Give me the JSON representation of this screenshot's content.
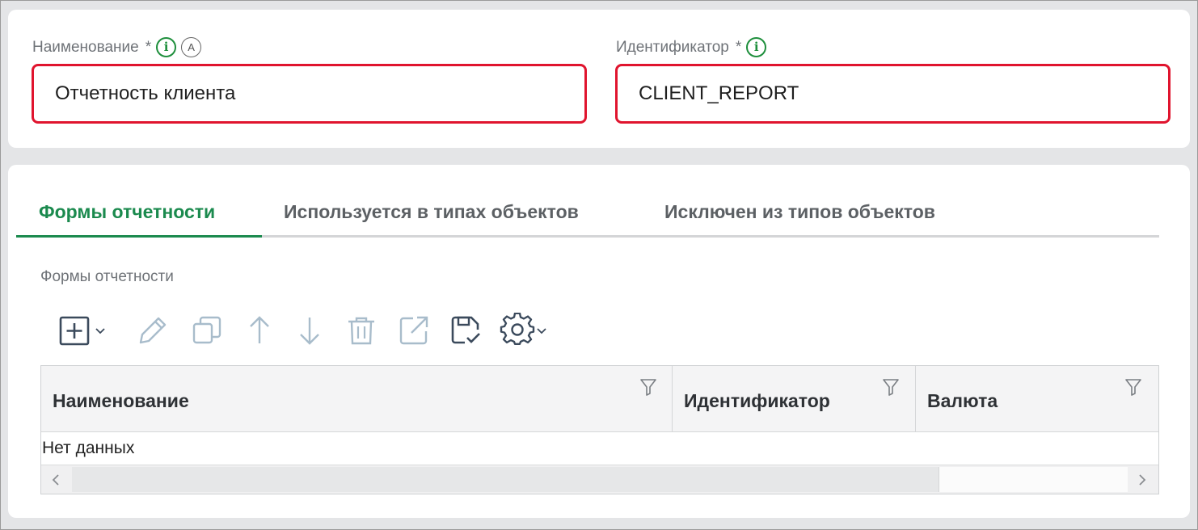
{
  "header_form": {
    "name_field": {
      "label": "Наименование",
      "required_mark": "*",
      "info_icon": "i",
      "auto_icon": "A",
      "value": "Отчетность клиента"
    },
    "id_field": {
      "label": "Идентификатор",
      "required_mark": "*",
      "info_icon": "i",
      "value": "CLIENT_REPORT"
    }
  },
  "tabs": [
    {
      "label": "Формы отчетности",
      "active": true
    },
    {
      "label": "Используется в типах объектов",
      "active": false
    },
    {
      "label": "Исключен из типов объектов",
      "active": false
    }
  ],
  "section": {
    "label": "Формы отчетности"
  },
  "toolbar": {
    "icons": [
      "add-icon",
      "edit-icon",
      "copy-icon",
      "move-up-icon",
      "move-down-icon",
      "delete-icon",
      "open-external-icon",
      "save-check-icon",
      "settings-icon"
    ]
  },
  "table": {
    "columns": [
      {
        "title": "Наименование"
      },
      {
        "title": "Идентификатор"
      },
      {
        "title": "Валюта"
      }
    ],
    "empty_text": "Нет данных"
  },
  "colors": {
    "accent_green": "#1b8a4e",
    "error_red": "#e0142e",
    "info_green": "#1e8f3c"
  }
}
